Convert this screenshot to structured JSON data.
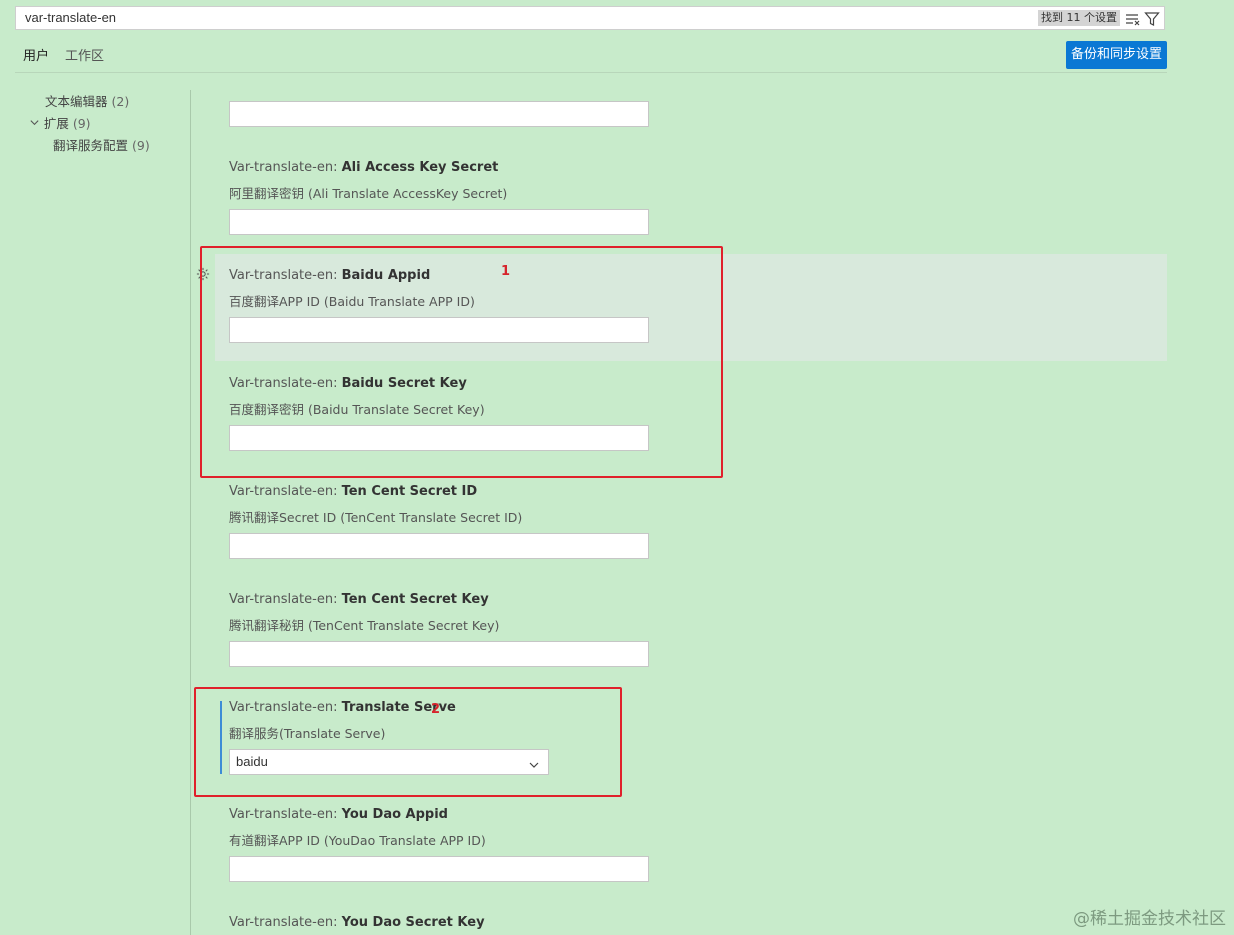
{
  "search": {
    "value": "var-translate-en",
    "result_count": "找到 11 个设置",
    "clear_icon": "clear-filter-icon",
    "filter_icon": "filter-icon"
  },
  "tabs": [
    {
      "label": "用户",
      "active": true
    },
    {
      "label": "工作区",
      "active": false
    }
  ],
  "sync_button": "备份和同步设置",
  "toc": [
    {
      "label": "文本编辑器",
      "count": "(2)"
    },
    {
      "label": "扩展",
      "count": "(9)",
      "expanded": true
    },
    {
      "label": "翻译服务配置",
      "count": "(9)"
    }
  ],
  "settings": [
    {
      "category": "Var-translate-en: ",
      "key": "Ali Access Key Secret",
      "description": "阿里翻译密钥 (Ali Translate AccessKey Secret)",
      "value": ""
    },
    {
      "category": "Var-translate-en: ",
      "key": "Baidu Appid",
      "description": "百度翻译APP ID (Baidu Translate APP ID)",
      "value": ""
    },
    {
      "category": "Var-translate-en: ",
      "key": "Baidu Secret Key",
      "description": "百度翻译密钥 (Baidu Translate Secret Key)",
      "value": ""
    },
    {
      "category": "Var-translate-en: ",
      "key": "Ten Cent Secret ID",
      "description": "腾讯翻译Secret ID (TenCent Translate Secret ID)",
      "value": ""
    },
    {
      "category": "Var-translate-en: ",
      "key": "Ten Cent Secret Key",
      "description": "腾讯翻译秘钥 (TenCent Translate Secret Key)",
      "value": ""
    },
    {
      "category": "Var-translate-en: ",
      "key": "Translate Serve",
      "description": "翻译服务(Translate Serve)",
      "value": "baidu"
    },
    {
      "category": "Var-translate-en: ",
      "key": "You Dao Appid",
      "description": "有道翻译APP ID (YouDao Translate APP ID)",
      "value": ""
    },
    {
      "category": "Var-translate-en: ",
      "key": "You Dao Secret Key"
    }
  ],
  "annotations": [
    "1",
    "2"
  ],
  "watermark": "@稀土掘金技术社区",
  "colors": {
    "background": "#c8ebcb",
    "accent_button": "#0a78d4",
    "annotation_red": "#e0202b",
    "modified_indicator": "#3d8cd6"
  }
}
